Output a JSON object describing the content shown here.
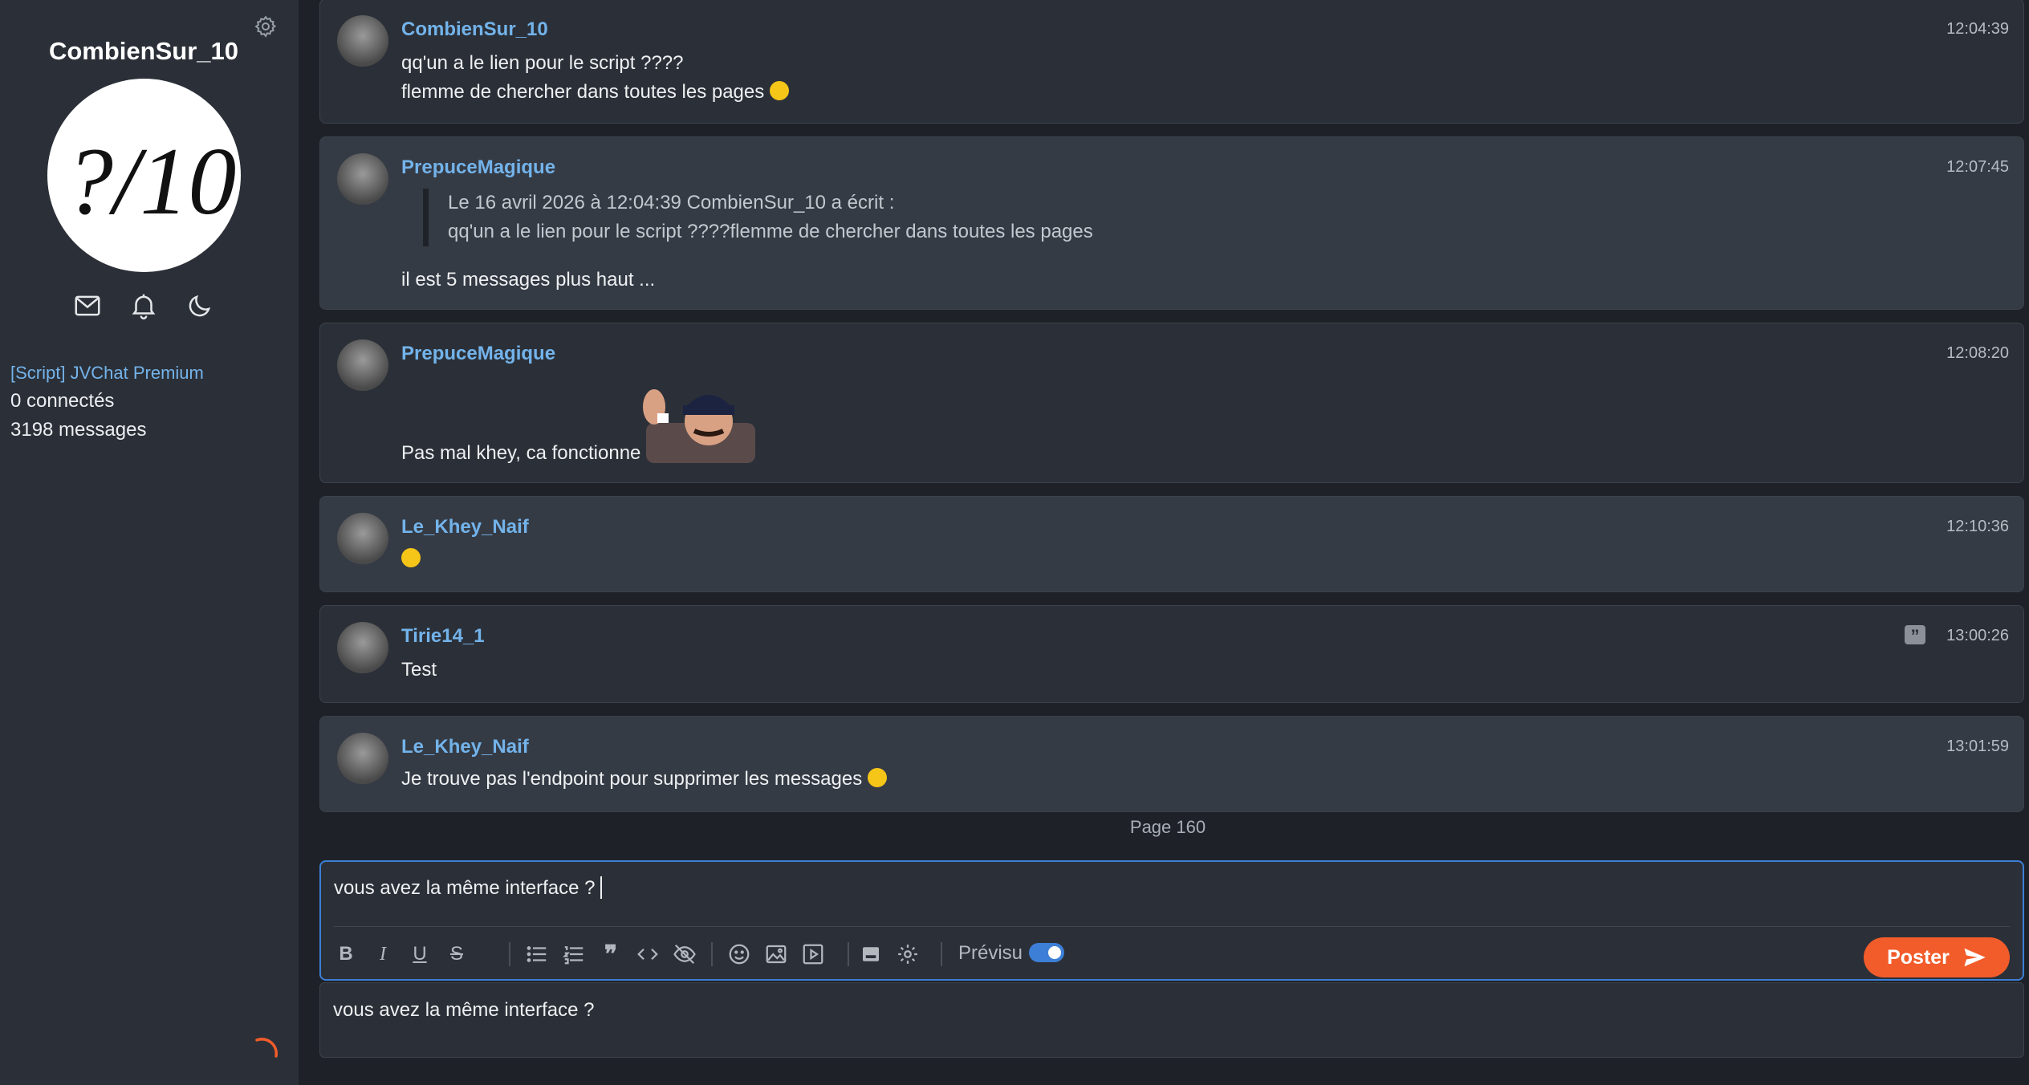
{
  "sidebar": {
    "username": "CombienSur_10",
    "avatar_text": "?/10",
    "topic_link": "[Script] JVChat Premium",
    "connected": "0 connectés",
    "messages_count": "3198 messages",
    "icons": [
      "settings-gear-icon",
      "mail-icon",
      "bell-icon",
      "moon-icon"
    ]
  },
  "messages": [
    {
      "author": "CombienSur_10",
      "time": "12:04:39",
      "lines": [
        "qq'un a le lien pour le script ????",
        "flemme de chercher dans toutes les pages"
      ]
    },
    {
      "author": "PrepuceMagique",
      "time": "12:07:45",
      "quote_header": "Le 16 avril 2026 à 12:04:39 CombienSur_10 a écrit :",
      "quote_text": "qq'un a le lien pour le script ????flemme de chercher dans toutes les pages",
      "lines": [
        "il est 5 messages plus haut ..."
      ]
    },
    {
      "author": "PrepuceMagique",
      "time": "12:08:20",
      "lines": [
        "Pas mal khey, ca fonctionne top !"
      ]
    },
    {
      "author": "Le_Khey_Naif",
      "time": "12:10:36",
      "lines": [
        ""
      ]
    },
    {
      "author": "Tirie14_1",
      "time": "13:00:26",
      "lines": [
        "Test"
      ]
    },
    {
      "author": "Le_Khey_Naif",
      "time": "13:01:59",
      "lines": [
        "Je trouve pas l'endpoint pour supprimer les messages"
      ]
    }
  ],
  "page_label": "Page 160",
  "editor": {
    "value": "vous avez la même interface ?",
    "previsu_label": "Prévisu",
    "previsu_enabled": true,
    "post_label": "Poster",
    "preview_text": "vous avez la même interface ?"
  },
  "colors": {
    "accent": "#3d7fd6",
    "post_button": "#f25c2a",
    "author": "#73b3ea",
    "background": "#1e2228",
    "panel": "#2b3038"
  }
}
